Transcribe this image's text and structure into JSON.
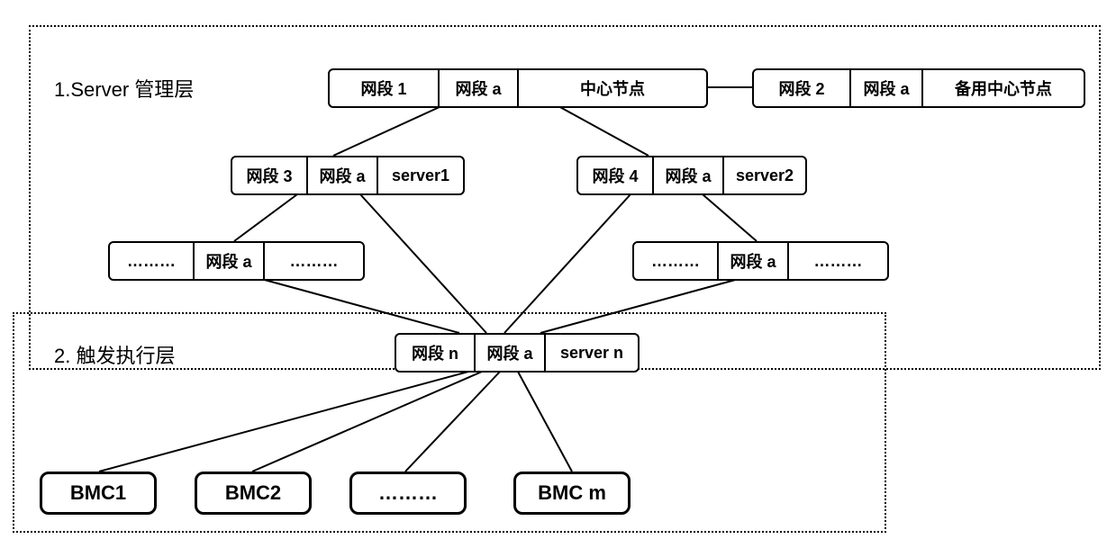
{
  "layers": {
    "server": {
      "label": "1.Server 管理层"
    },
    "trigger": {
      "label": "2. 触发执行层"
    }
  },
  "nodes": {
    "center": {
      "c1": "网段 1",
      "c2": "网段 a",
      "c3": "中心节点"
    },
    "backup": {
      "c1": "网段 2",
      "c2": "网段 a",
      "c3": "备用中心节点"
    },
    "srv1": {
      "c1": "网段 3",
      "c2": "网段 a",
      "c3": "server1"
    },
    "srv2": {
      "c1": "网段 4",
      "c2": "网段 a",
      "c3": "server2"
    },
    "dotL": {
      "c1": "………",
      "c2": "网段 a",
      "c3": "………"
    },
    "dotR": {
      "c1": "………",
      "c2": "网段 a",
      "c3": "………"
    },
    "srvN": {
      "c1": "网段 n",
      "c2": "网段 a",
      "c3": "server n"
    }
  },
  "bmc": {
    "b1": "BMC1",
    "b2": "BMC2",
    "b3": "………",
    "b4": "BMC m"
  }
}
